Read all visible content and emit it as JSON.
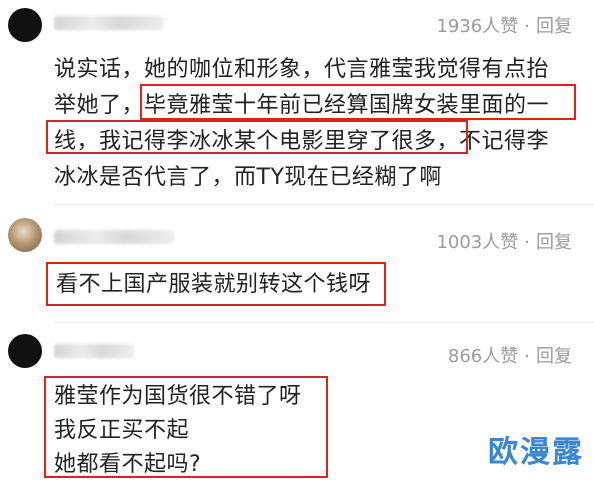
{
  "comments": [
    {
      "likes": "1936人赞",
      "reply": "回复",
      "lines": [
        "说实话，她的咖位和形象，代言雅莹我觉得有点抬",
        "举她了，毕竟雅莹十年前已经算国牌女装里面的一",
        "线，我记得李冰冰某个电影里穿了很多，不记得李",
        "冰冰是否代言了，而TY现在已经糊了啊"
      ]
    },
    {
      "likes": "1003人赞",
      "reply": "回复",
      "lines": [
        "看不上国产服装就别转这个钱呀"
      ]
    },
    {
      "likes": "866人赞",
      "reply": "回复",
      "lines": [
        "雅莹作为国货很不错了呀",
        "我反正买不起",
        "她都看不起吗?"
      ]
    }
  ],
  "meta_separator": "·",
  "highlight_color": "#d8261f",
  "watermark": "欧漫露"
}
